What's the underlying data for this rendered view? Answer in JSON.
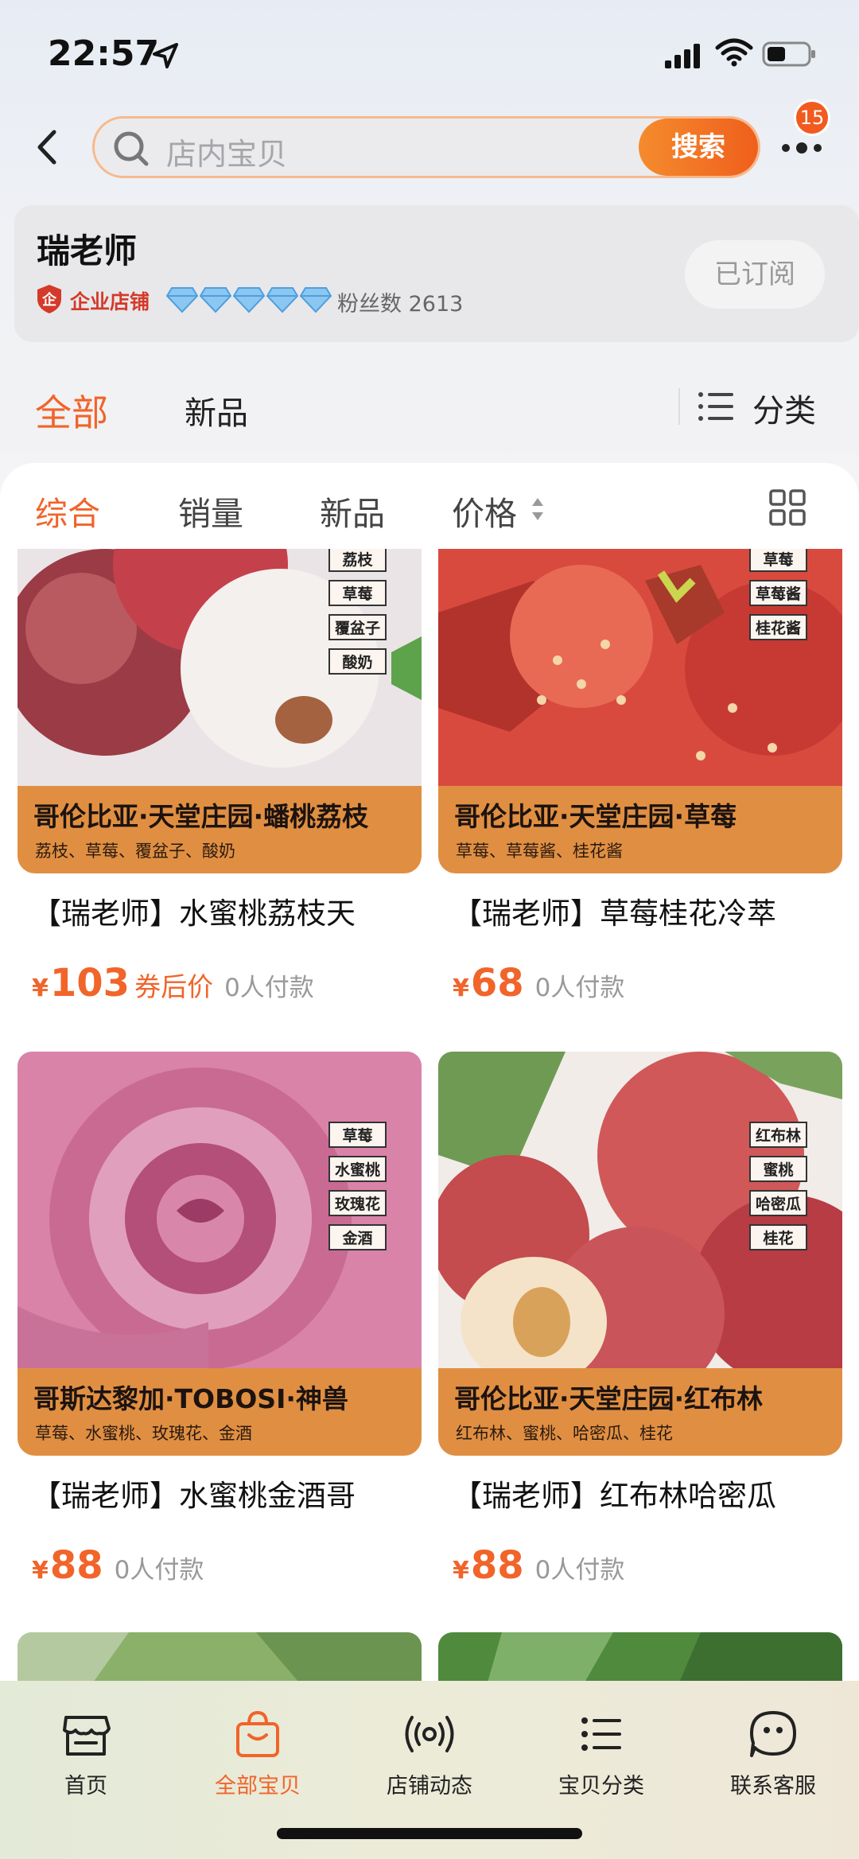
{
  "status_bar": {
    "time": "22:57"
  },
  "search": {
    "placeholder": "店内宝贝",
    "button_label": "搜索",
    "badge_count": "15"
  },
  "store": {
    "name": "瑞老师",
    "enterprise_label": "企业店铺",
    "diamond_count": 5,
    "fans": "粉丝数 2613",
    "subscribe_label": "已订阅"
  },
  "top_tabs": {
    "all": "全部",
    "new": "新品",
    "category": "分类"
  },
  "sort_tabs": {
    "overall": "综合",
    "sales": "销量",
    "new": "新品",
    "price": "价格"
  },
  "products": [
    {
      "banner_title": "哥伦比亚·天堂庄园·蟠桃荔枝",
      "banner_sub": "荔枝、草莓、覆盆子、酸奶",
      "tags": [
        "荔枝",
        "草莓",
        "覆盆子",
        "酸奶"
      ],
      "title": "【瑞老师】水蜜桃荔枝天",
      "currency": "¥",
      "price": "103",
      "coupon": "券后价",
      "paid": "0人付款"
    },
    {
      "banner_title": "哥伦比亚·天堂庄园·草莓",
      "banner_sub": "草莓、草莓酱、桂花酱",
      "tags": [
        "草莓",
        "草莓酱",
        "桂花酱"
      ],
      "title": "【瑞老师】草莓桂花冷萃",
      "currency": "¥",
      "price": "68",
      "paid": "0人付款"
    },
    {
      "banner_title": "哥斯达黎加·TOBOSI·神兽",
      "banner_sub": "草莓、水蜜桃、玫瑰花、金酒",
      "tags": [
        "草莓",
        "水蜜桃",
        "玫瑰花",
        "金酒"
      ],
      "title": "【瑞老师】水蜜桃金酒哥",
      "currency": "¥",
      "price": "88",
      "paid": "0人付款"
    },
    {
      "banner_title": "哥伦比亚·天堂庄园·红布林",
      "banner_sub": "红布林、蜜桃、哈密瓜、桂花",
      "tags": [
        "红布林",
        "蜜桃",
        "哈密瓜",
        "桂花"
      ],
      "title": "【瑞老师】红布林哈密瓜",
      "currency": "¥",
      "price": "88",
      "paid": "0人付款"
    }
  ],
  "bottom_nav": {
    "home": "首页",
    "all_items": "全部宝贝",
    "store_updates": "店铺动态",
    "categories": "宝贝分类",
    "customer_service": "联系客服"
  },
  "colors": {
    "accent": "#f1642a",
    "banner": "#e08f42",
    "badge": "#f25a1f"
  }
}
